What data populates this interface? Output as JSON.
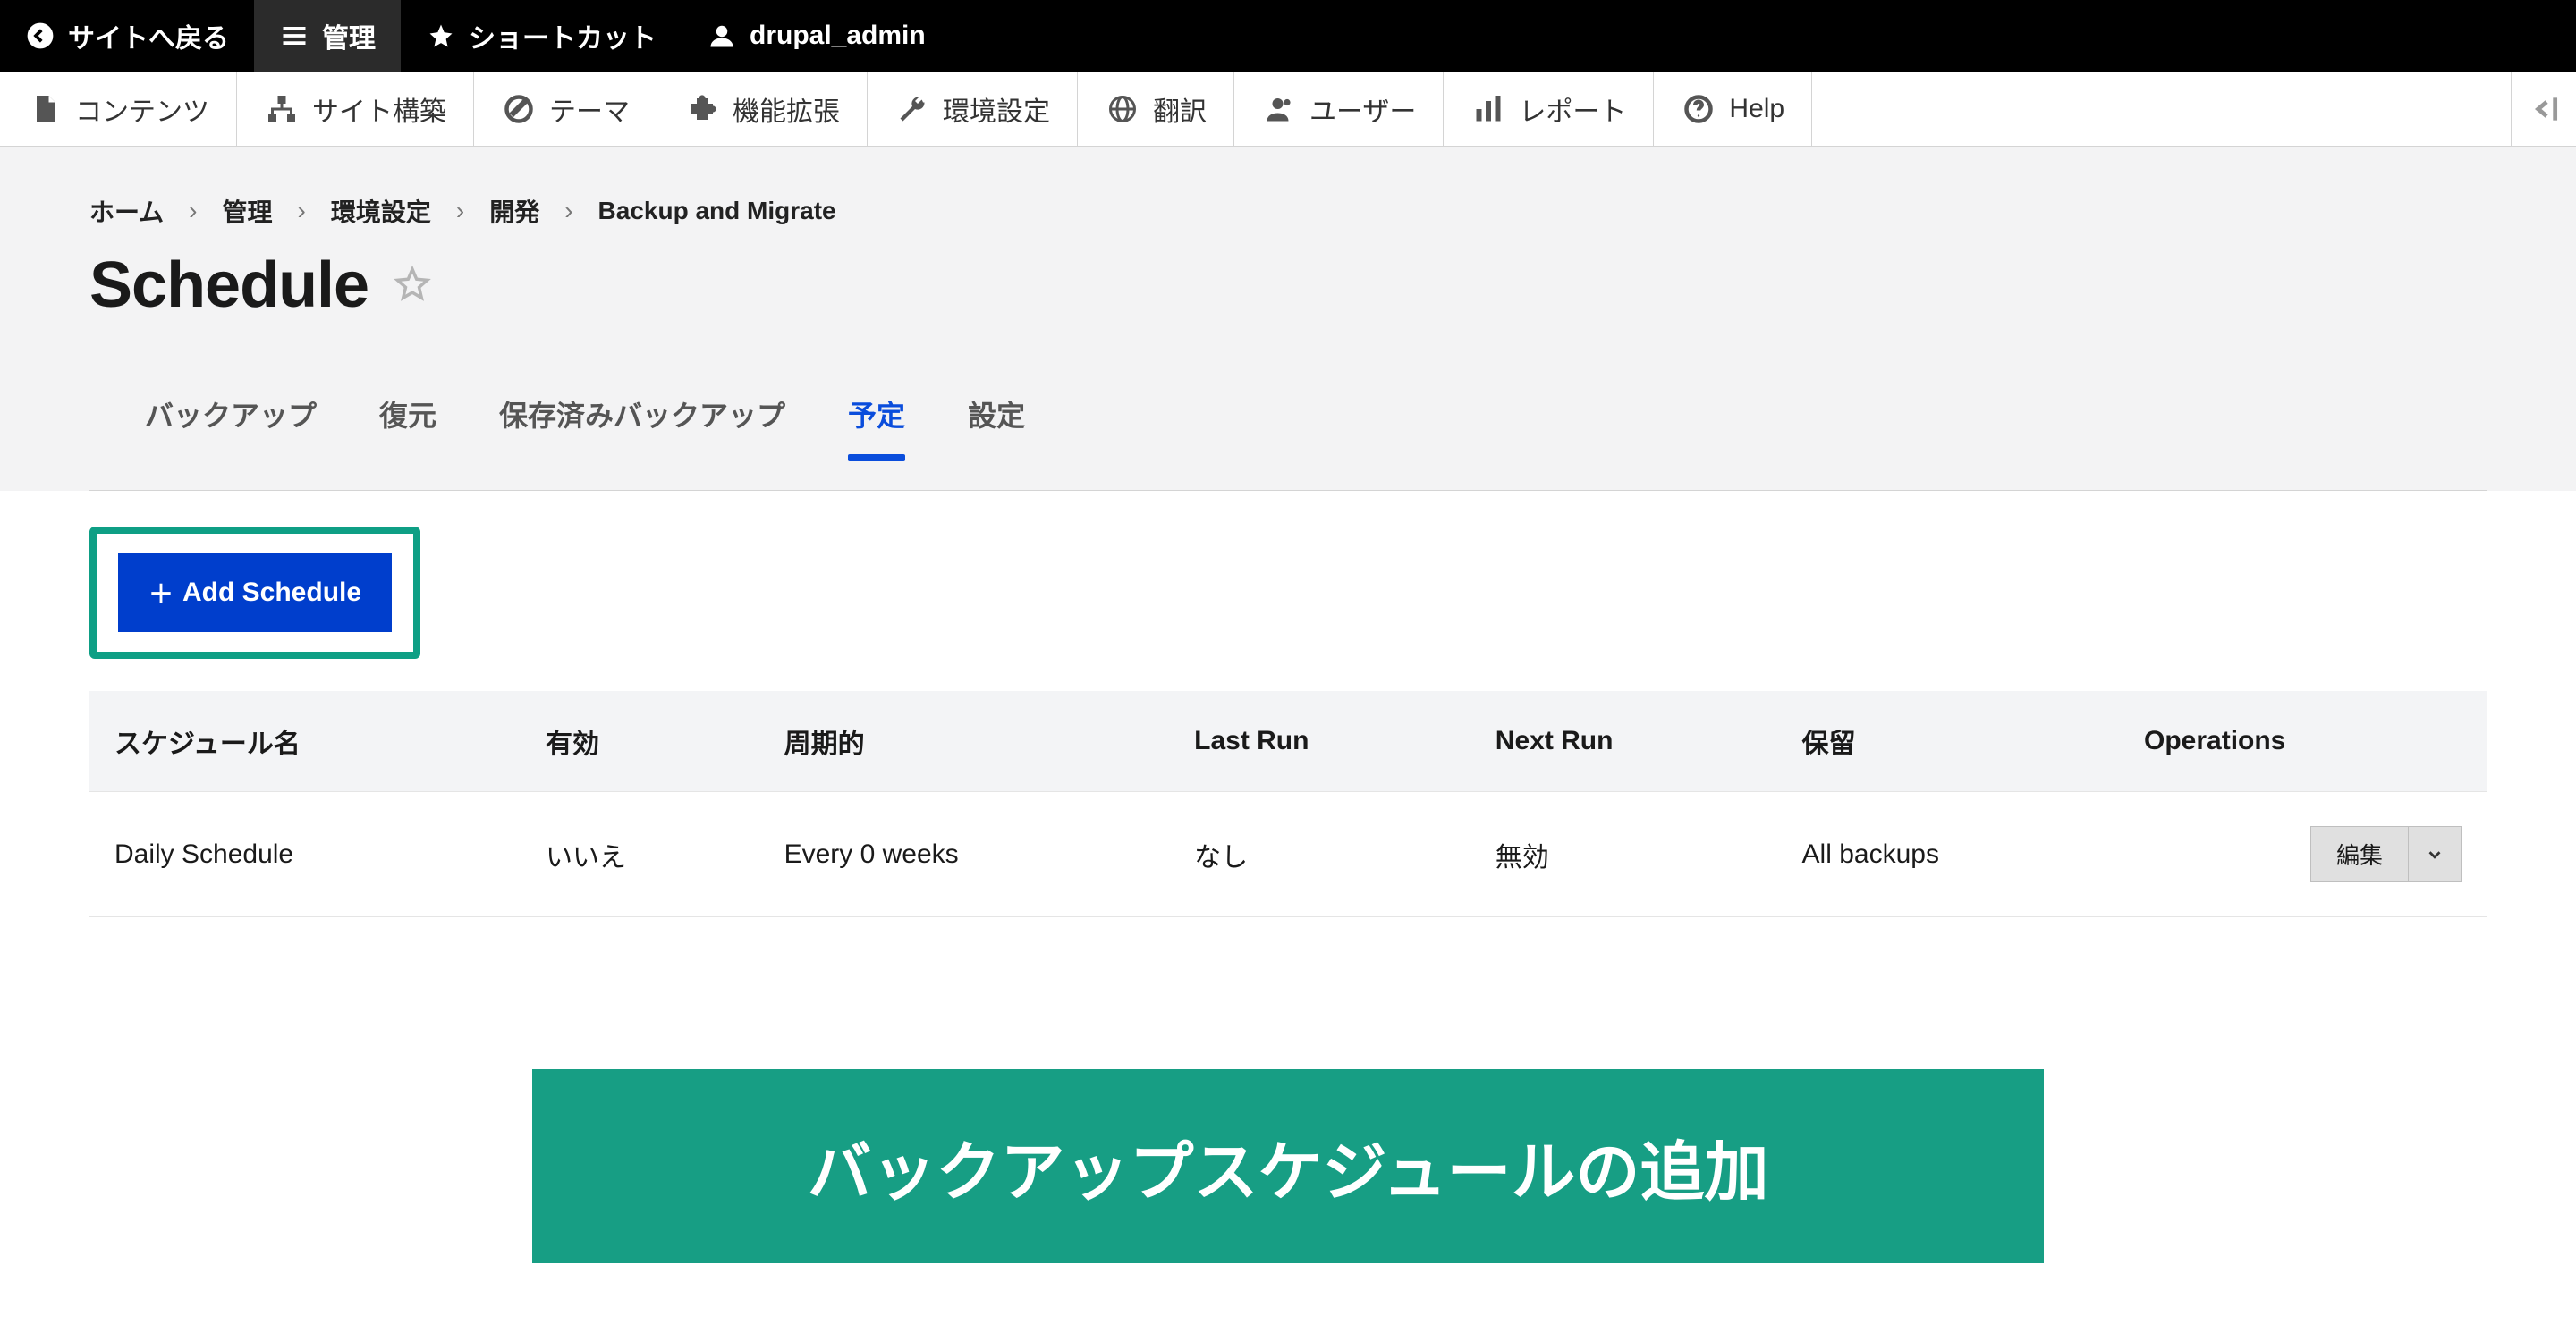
{
  "topbar": {
    "back_to_site": "サイトへ戻る",
    "manage": "管理",
    "shortcuts": "ショートカット",
    "username": "drupal_admin"
  },
  "menubar": {
    "items": [
      {
        "label": "コンテンツ",
        "icon": "file"
      },
      {
        "label": "サイト構築",
        "icon": "structure"
      },
      {
        "label": "テーマ",
        "icon": "wand"
      },
      {
        "label": "機能拡張",
        "icon": "puzzle"
      },
      {
        "label": "環境設定",
        "icon": "wrench"
      },
      {
        "label": "翻訳",
        "icon": "globe"
      },
      {
        "label": "ユーザー",
        "icon": "user"
      },
      {
        "label": "レポート",
        "icon": "chart"
      },
      {
        "label": "Help",
        "icon": "help"
      }
    ]
  },
  "breadcrumb": [
    "ホーム",
    "管理",
    "環境設定",
    "開発",
    "Backup and Migrate"
  ],
  "page_title": "Schedule",
  "tabs": [
    {
      "label": "バックアップ",
      "active": false
    },
    {
      "label": "復元",
      "active": false
    },
    {
      "label": "保存済みバックアップ",
      "active": false
    },
    {
      "label": "予定",
      "active": true
    },
    {
      "label": "設定",
      "active": false
    }
  ],
  "add_button": "Add Schedule",
  "table": {
    "headers": [
      "スケジュール名",
      "有効",
      "周期的",
      "Last Run",
      "Next Run",
      "保留",
      "Operations"
    ],
    "rows": [
      {
        "name": "Daily Schedule",
        "enabled": "いいえ",
        "period": "Every 0 weeks",
        "last_run": "なし",
        "next_run": "無効",
        "keep": "All backups",
        "op": "編集"
      }
    ]
  },
  "banner": "バックアップスケジュールの追加"
}
